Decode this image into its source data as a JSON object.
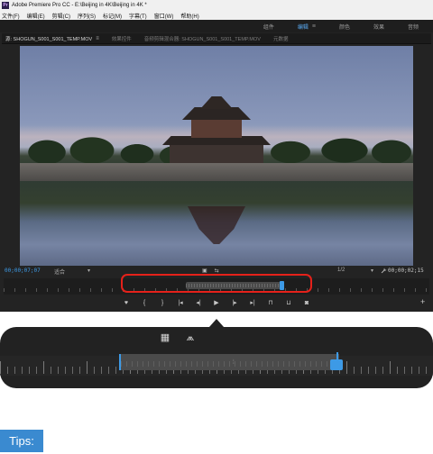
{
  "window": {
    "title": "Adobe Premiere Pro CC - E:\\Beijing in 4K\\Beijing in 4K *",
    "app_icon": "Pr"
  },
  "menu": {
    "items": [
      "文件(F)",
      "编辑(E)",
      "剪辑(C)",
      "序列(S)",
      "标记(M)",
      "字幕(T)",
      "窗口(W)",
      "帮助(H)"
    ]
  },
  "workspaces": {
    "items": [
      {
        "label": "组件",
        "active": false
      },
      {
        "label": "编辑",
        "active": true
      },
      {
        "label": "颜色",
        "active": false
      },
      {
        "label": "效果",
        "active": false
      },
      {
        "label": "音频",
        "active": false
      }
    ],
    "menu_glyph": "≡"
  },
  "panel_tabs": [
    {
      "label": "源: SHOGUN_S001_S001_TEMP.MOV",
      "active": true
    },
    {
      "label": "效果控件",
      "active": false
    },
    {
      "label": "音频剪辑混合器: SHOGUN_S001_S001_TEMP.MOV",
      "active": false
    },
    {
      "label": "元数据",
      "active": false
    }
  ],
  "monitor": {
    "timecode_in": "00;00;07;07",
    "fit_label": "适合",
    "resolution_label": "1/2",
    "timecode_out": "00;00;02;15",
    "dropdown_glyph": "▾",
    "center_icons": [
      "▣",
      "⇆"
    ]
  },
  "transport": {
    "buttons": [
      {
        "name": "add-marker",
        "glyph": "♥"
      },
      {
        "name": "mark-in",
        "glyph": "{"
      },
      {
        "name": "mark-out",
        "glyph": "}"
      },
      {
        "name": "go-to-in",
        "glyph": "|◂"
      },
      {
        "name": "step-back",
        "glyph": "◂|"
      },
      {
        "name": "play",
        "glyph": "▶"
      },
      {
        "name": "step-forward",
        "glyph": "|▸"
      },
      {
        "name": "go-to-out",
        "glyph": "▸|"
      },
      {
        "name": "insert",
        "glyph": "⊓"
      },
      {
        "name": "overwrite",
        "glyph": "⊔"
      },
      {
        "name": "export-frame",
        "glyph": "◙"
      }
    ],
    "plus": "+"
  },
  "callout": {
    "icons": [
      {
        "name": "film-strip-icon",
        "glyph": "▦"
      },
      {
        "name": "audio-waveform-icon",
        "glyph": "⩕"
      }
    ],
    "grip": "⦙"
  },
  "tips": {
    "label": "Tips:"
  },
  "colors": {
    "accent_blue": "#3d9ae6",
    "highlight_red": "#e5211a",
    "tips_bg": "#3a8ad0"
  }
}
